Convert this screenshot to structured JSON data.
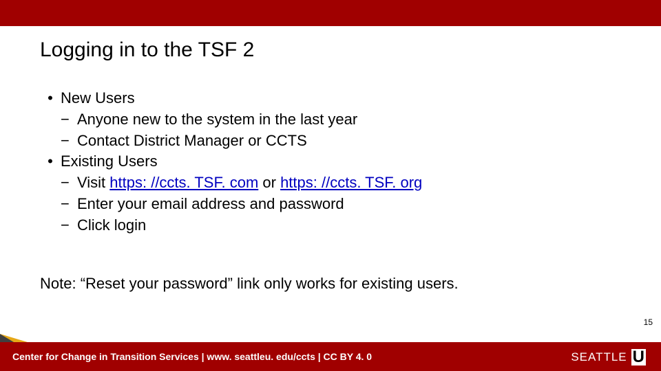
{
  "title": "Logging in to the TSF 2",
  "bullets": {
    "b0": "New Users",
    "b0_0": "Anyone new to the system in the last year",
    "b0_1": "Contact District Manager or CCTS",
    "b1": "Existing Users",
    "b1_0_prefix": "Visit ",
    "b1_0_link1": "https: //ccts. TSF. com",
    "b1_0_mid": " or ",
    "b1_0_link2": "https: //ccts. TSF. org",
    "b1_1": "Enter your email address and password",
    "b1_2": "Click login"
  },
  "note": "Note: “Reset your password” link only works for existing users.",
  "pagenum": "15",
  "footer": "Center for Change in Transition Services | www. seattleu. edu/ccts | CC BY 4. 0",
  "logo": {
    "name": "SEATTLE",
    "u": "U"
  },
  "glyphs": {
    "l1": "•",
    "l2": "−"
  }
}
